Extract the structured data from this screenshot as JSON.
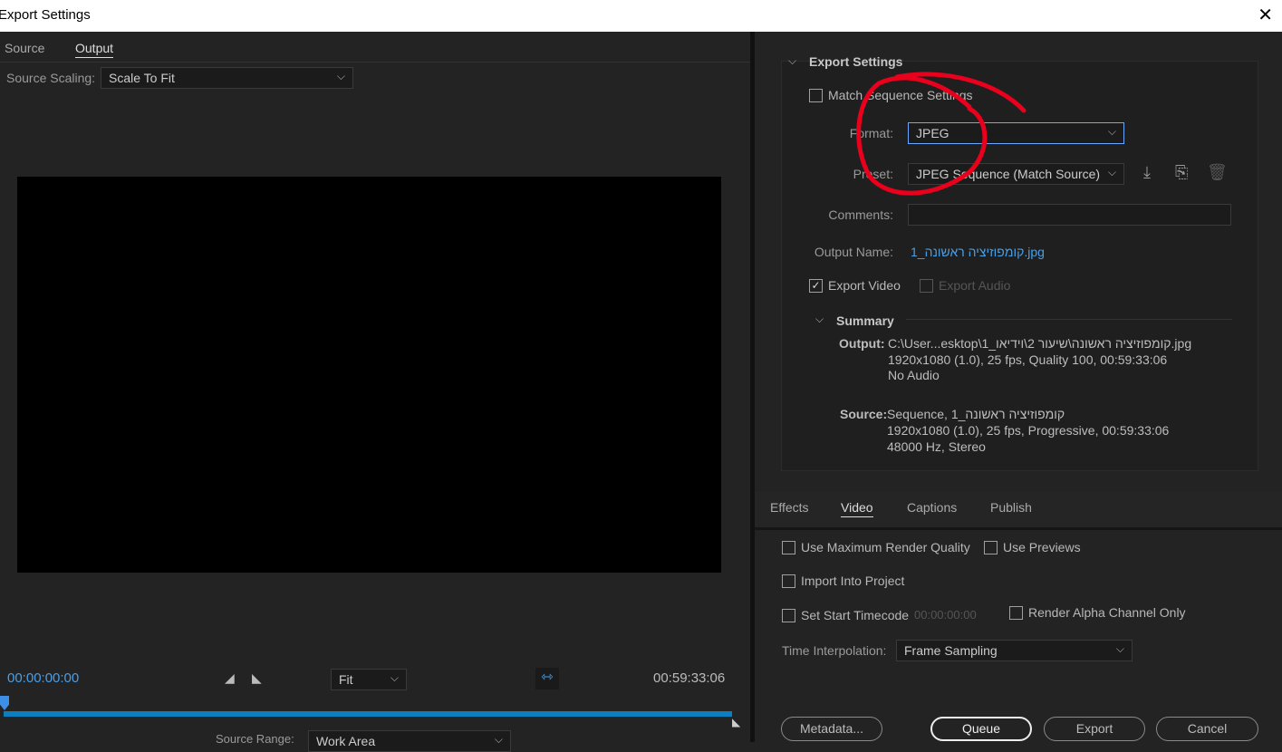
{
  "window": {
    "title": "Export Settings",
    "close": "✕"
  },
  "left": {
    "tabs": [
      "Source",
      "Output"
    ],
    "source_scaling_label": "Source Scaling:",
    "source_scaling_value": "Scale To Fit",
    "timecode_start": "00:00:00:00",
    "timecode_end": "00:59:33:06",
    "zoom_value": "Fit",
    "source_range_label": "Source Range:",
    "source_range_value": "Work Area",
    "playhead_fraction": 0
  },
  "export": {
    "section_title": "Export Settings",
    "match_sequence": "Match Sequence Settings",
    "format_label": "Format:",
    "format_value": "JPEG",
    "preset_label": "Preset:",
    "preset_value": "JPEG Sequence (Match Source)",
    "comments_label": "Comments:",
    "comments_value": "",
    "output_name_label": "Output Name:",
    "output_name_value": "קומפוזיציה ראשונה_1.jpg",
    "export_video": "Export Video",
    "export_audio": "Export Audio",
    "summary_title": "Summary",
    "summary_output_label": "Output:",
    "summary_output_lines": [
      "C:\\User...esktop\\1_קומפוזיציה ראשונה\\שיעור 2\\וידיאו.jpg",
      "1920x1080 (1.0), 25 fps, Quality 100, 00:59:33:06",
      "No Audio"
    ],
    "summary_source_label": "Source:",
    "summary_source_lines": [
      "Sequence, 1_קומפוזיציה ראשונה",
      "1920x1080 (1.0), 25 fps, Progressive, 00:59:33:06",
      "48000 Hz, Stereo"
    ]
  },
  "tabs": [
    "Effects",
    "Video",
    "Captions",
    "Publish"
  ],
  "video": {
    "max_render": "Use Maximum Render Quality",
    "use_previews": "Use Previews",
    "import_project": "Import Into Project",
    "start_timecode": "Set Start Timecode",
    "start_timecode_value": "00:00:00:00",
    "alpha_only": "Render Alpha Channel Only",
    "time_interp_label": "Time Interpolation:",
    "time_interp_value": "Frame Sampling"
  },
  "buttons": {
    "metadata": "Metadata...",
    "queue": "Queue",
    "export": "Export",
    "cancel": "Cancel"
  },
  "colors": {
    "accent": "#4a9fe6",
    "annotation": "#e8001c"
  }
}
